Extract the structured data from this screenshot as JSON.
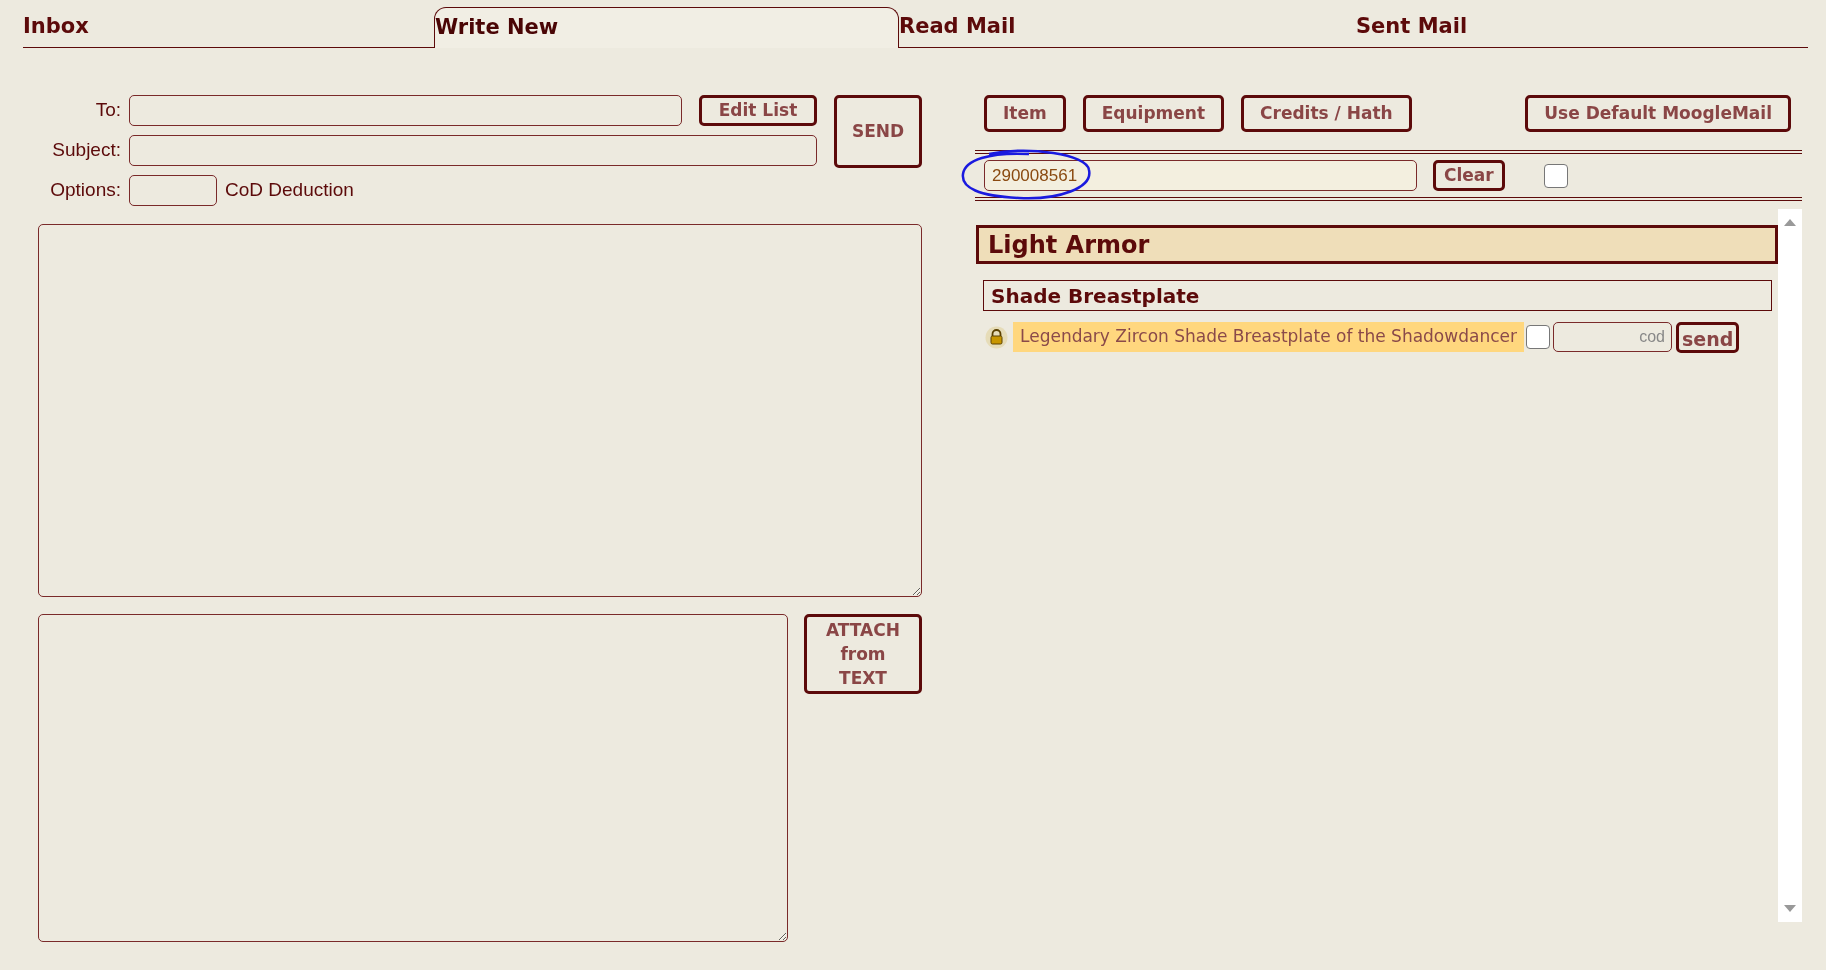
{
  "tabs": [
    {
      "label": "Inbox",
      "selected": false
    },
    {
      "label": "Write New",
      "selected": true
    },
    {
      "label": "Read Mail",
      "selected": false
    },
    {
      "label": "Sent Mail",
      "selected": false
    }
  ],
  "compose": {
    "to_label": "To:",
    "edit_list_button": "Edit List",
    "send_button": "SEND",
    "subject_label": "Subject:",
    "options_label": "Options:",
    "cod_label": "CoD Deduction",
    "attach_button": [
      "ATTACH",
      "from",
      "TEXT"
    ]
  },
  "attach_panel": {
    "buttons": [
      "Item",
      "Equipment",
      "Credits / Hath"
    ],
    "default_button": "Use Default MoogleMail",
    "search_value": "290008561",
    "search_annotated": true,
    "clear_button": "Clear",
    "filter_checked": false,
    "category": "Light Armor",
    "group": "Shade Breastplate",
    "items": [
      {
        "name": "Legendary Zircon Shade Breastplate of the Shadowdancer",
        "locked": true,
        "checked": false,
        "cod_placeholder": "cod",
        "send_button": "send"
      }
    ]
  }
}
